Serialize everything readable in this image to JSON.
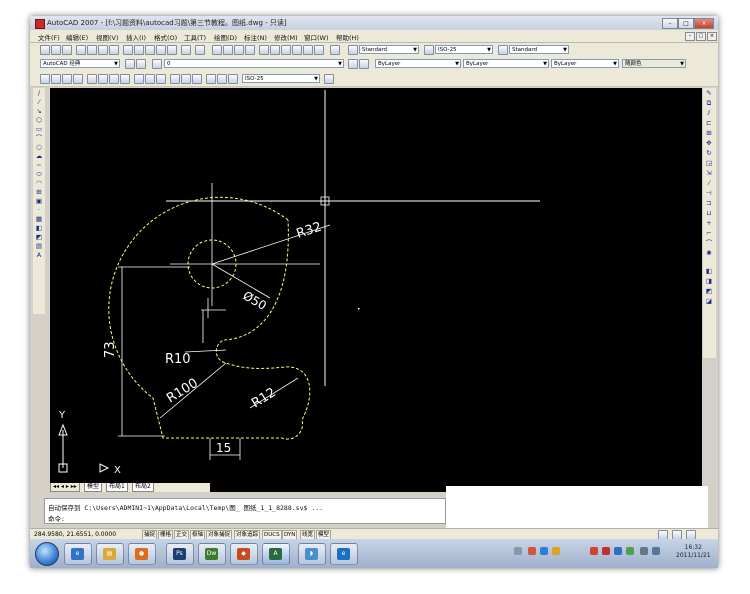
{
  "window": {
    "title": "AutoCAD 2007 - [f:\\习题资料\\autocad习题\\第三节教程。图纸.dwg - 只读]",
    "controls": {
      "minimize": "–",
      "maximize": "□",
      "close": "×"
    }
  },
  "menubar": {
    "items": [
      "文件(F)",
      "编辑(E)",
      "视图(V)",
      "插入(I)",
      "格式(O)",
      "工具(T)",
      "绘图(D)",
      "标注(N)",
      "修改(M)",
      "窗口(W)",
      "帮助(H)"
    ]
  },
  "toolbar": {
    "text_style": "Standard",
    "dim_style": "ISO-25",
    "table_style": "Standard",
    "workspace": "AutoCAD 经典",
    "layer": "0",
    "layer_color": "ByLayer",
    "linetype": "ByLayer",
    "lineweight": "ByLayer",
    "plot_style": "随颜色",
    "dim_style_2": "ISO-25"
  },
  "drawing": {
    "dim_r32": "R32",
    "dim_d50": "Ø50",
    "dim_r10": "R10",
    "dim_r100": "R100",
    "dim_r12": "R12",
    "dim_73": "73",
    "dim_15": "15",
    "ucs_y": "Y",
    "ucs_x": "X"
  },
  "layout_tabs": {
    "model": "模型",
    "layout1": "布局1",
    "layout2": "布局2"
  },
  "command": {
    "line1": "自动保存到 C:\\Users\\ADMINI~1\\AppData\\Local\\Temp\\图_ 图纸_1_1_8288.sv$ ...",
    "line2": "命令:"
  },
  "statusbar": {
    "coords": "284.9580, 21.6551, 0.0000",
    "buttons": [
      "捕捉",
      "栅格",
      "正交",
      "极轴",
      "对象捕捉",
      "对象追踪",
      "DUCS",
      "DYN",
      "线宽",
      "模型"
    ]
  },
  "taskbar": {
    "apps": [
      "ie",
      "explorer",
      "firefox",
      "photoshop",
      "dreamweaver",
      "app",
      "autocad",
      "media",
      "ie2"
    ],
    "clock_time": "16:32",
    "clock_date": "2011/11/21"
  },
  "colors": {
    "canvas": "#000000",
    "crosshair": "#ffffff",
    "geometry": "#ffff66",
    "titlebar": "#c5d0de"
  }
}
